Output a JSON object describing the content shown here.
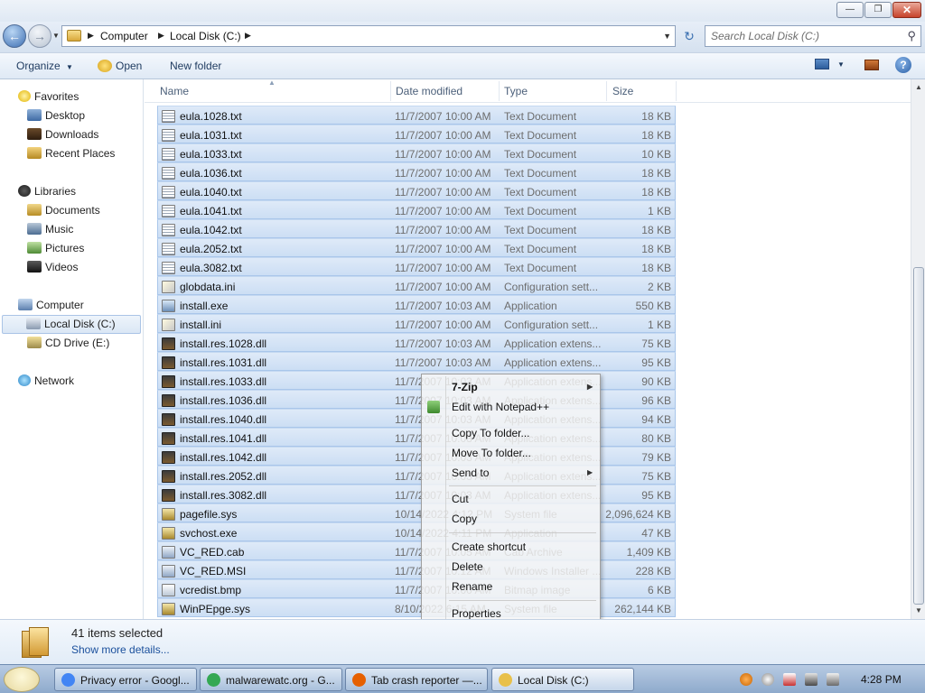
{
  "window": {
    "caption_buttons": [
      "minimize",
      "maximize",
      "close"
    ]
  },
  "address": {
    "crumbs": [
      "Computer",
      "Local Disk (C:)"
    ],
    "search_placeholder": "Search Local Disk (C:)"
  },
  "toolbar": {
    "organize": "Organize",
    "open": "Open",
    "new_folder": "New folder"
  },
  "nav": {
    "favorites": "Favorites",
    "desktop": "Desktop",
    "downloads": "Downloads",
    "recent_places": "Recent Places",
    "libraries": "Libraries",
    "documents": "Documents",
    "music": "Music",
    "pictures": "Pictures",
    "videos": "Videos",
    "computer": "Computer",
    "local_disk": "Local Disk (C:)",
    "cd_drive": "CD Drive (E:)",
    "network": "Network"
  },
  "columns": {
    "name": "Name",
    "date": "Date modified",
    "type": "Type",
    "size": "Size"
  },
  "files": [
    {
      "name": "eula.1028.txt",
      "date": "11/7/2007 10:00 AM",
      "type": "Text Document",
      "size": "18 KB",
      "icon": "txt"
    },
    {
      "name": "eula.1031.txt",
      "date": "11/7/2007 10:00 AM",
      "type": "Text Document",
      "size": "18 KB",
      "icon": "txt"
    },
    {
      "name": "eula.1033.txt",
      "date": "11/7/2007 10:00 AM",
      "type": "Text Document",
      "size": "10 KB",
      "icon": "txt"
    },
    {
      "name": "eula.1036.txt",
      "date": "11/7/2007 10:00 AM",
      "type": "Text Document",
      "size": "18 KB",
      "icon": "txt"
    },
    {
      "name": "eula.1040.txt",
      "date": "11/7/2007 10:00 AM",
      "type": "Text Document",
      "size": "18 KB",
      "icon": "txt"
    },
    {
      "name": "eula.1041.txt",
      "date": "11/7/2007 10:00 AM",
      "type": "Text Document",
      "size": "1 KB",
      "icon": "txt"
    },
    {
      "name": "eula.1042.txt",
      "date": "11/7/2007 10:00 AM",
      "type": "Text Document",
      "size": "18 KB",
      "icon": "txt"
    },
    {
      "name": "eula.2052.txt",
      "date": "11/7/2007 10:00 AM",
      "type": "Text Document",
      "size": "18 KB",
      "icon": "txt"
    },
    {
      "name": "eula.3082.txt",
      "date": "11/7/2007 10:00 AM",
      "type": "Text Document",
      "size": "18 KB",
      "icon": "txt"
    },
    {
      "name": "globdata.ini",
      "date": "11/7/2007 10:00 AM",
      "type": "Configuration sett...",
      "size": "2 KB",
      "icon": "ini"
    },
    {
      "name": "install.exe",
      "date": "11/7/2007 10:03 AM",
      "type": "Application",
      "size": "550 KB",
      "icon": "exe"
    },
    {
      "name": "install.ini",
      "date": "11/7/2007 10:00 AM",
      "type": "Configuration sett...",
      "size": "1 KB",
      "icon": "ini"
    },
    {
      "name": "install.res.1028.dll",
      "date": "11/7/2007 10:03 AM",
      "type": "Application extens...",
      "size": "75 KB",
      "icon": "dll"
    },
    {
      "name": "install.res.1031.dll",
      "date": "11/7/2007 10:03 AM",
      "type": "Application extens...",
      "size": "95 KB",
      "icon": "dll"
    },
    {
      "name": "install.res.1033.dll",
      "date": "11/7/2007 10:03 AM",
      "type": "Application extens...",
      "size": "90 KB",
      "icon": "dll"
    },
    {
      "name": "install.res.1036.dll",
      "date": "11/7/2007 10:03 AM",
      "type": "Application extens...",
      "size": "96 KB",
      "icon": "dll"
    },
    {
      "name": "install.res.1040.dll",
      "date": "11/7/2007 10:03 AM",
      "type": "Application extens...",
      "size": "94 KB",
      "icon": "dll"
    },
    {
      "name": "install.res.1041.dll",
      "date": "11/7/2007 10:03 AM",
      "type": "Application extens...",
      "size": "80 KB",
      "icon": "dll"
    },
    {
      "name": "install.res.1042.dll",
      "date": "11/7/2007 10:03 AM",
      "type": "Application extens...",
      "size": "79 KB",
      "icon": "dll"
    },
    {
      "name": "install.res.2052.dll",
      "date": "11/7/2007 10:03 AM",
      "type": "Application extens...",
      "size": "75 KB",
      "icon": "dll"
    },
    {
      "name": "install.res.3082.dll",
      "date": "11/7/2007 10:03 AM",
      "type": "Application extens...",
      "size": "95 KB",
      "icon": "dll"
    },
    {
      "name": "pagefile.sys",
      "date": "10/14/2022 4:12 PM",
      "type": "System file",
      "size": "2,096,624 KB",
      "icon": "sys"
    },
    {
      "name": "svchost.exe",
      "date": "10/14/2022 4:11 PM",
      "type": "Application",
      "size": "47 KB",
      "icon": "sys"
    },
    {
      "name": "VC_RED.cab",
      "date": "11/7/2007 10:05 AM",
      "type": "Cab Archive",
      "size": "1,409 KB",
      "icon": "cab"
    },
    {
      "name": "VC_RED.MSI",
      "date": "11/7/2007 10:12 AM",
      "type": "Windows Installer ...",
      "size": "228 KB",
      "icon": "cab"
    },
    {
      "name": "vcredist.bmp",
      "date": "11/7/2007 10:00 AM",
      "type": "Bitmap image",
      "size": "6 KB",
      "icon": "bmp"
    },
    {
      "name": "WinPEpge.sys",
      "date": "8/10/2022 6:15 AM",
      "type": "System file",
      "size": "262,144 KB",
      "icon": "sys"
    }
  ],
  "context_menu": {
    "seven_zip": "7-Zip",
    "edit_notepad": "Edit with Notepad++",
    "copy_to": "Copy To folder...",
    "move_to": "Move To folder...",
    "send_to": "Send to",
    "cut": "Cut",
    "copy": "Copy",
    "create_shortcut": "Create shortcut",
    "delete": "Delete",
    "rename": "Rename",
    "properties": "Properties"
  },
  "details": {
    "selected": "41 items selected",
    "more": "Show more details..."
  },
  "taskbar": {
    "items": [
      {
        "label": "Privacy error - Googl...",
        "color": "#4285f4"
      },
      {
        "label": "malwarewatc.org - G...",
        "color": "#34a853"
      },
      {
        "label": "Tab crash reporter —...",
        "color": "#e66000"
      },
      {
        "label": "Local Disk (C:)",
        "color": "#e8c04a"
      }
    ],
    "clock": "4:28 PM"
  },
  "colors": {
    "selection_fill": "#ccdef4",
    "selection_border": "#a9c6ea",
    "link": "#1a4f9c"
  }
}
